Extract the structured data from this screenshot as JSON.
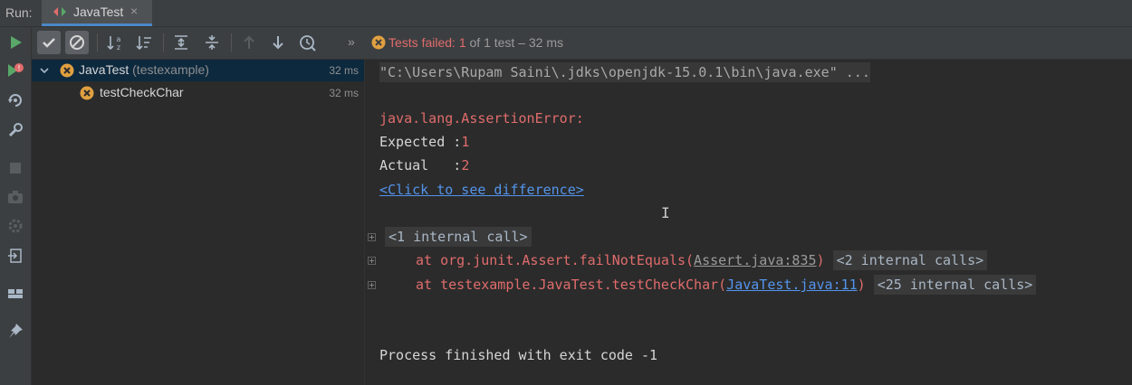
{
  "run_bar": {
    "label": "Run:",
    "tab_title": "JavaTest",
    "close_glyph": "×"
  },
  "left_toolbar": {
    "icons": [
      "run-icon",
      "rerun-failed-icon",
      "rerun-icon",
      "settings-wrench-icon",
      "stop-icon",
      "camera-icon",
      "gear-icon",
      "export-icon",
      "layout-icon",
      "pin-icon"
    ]
  },
  "test_toolbar": {
    "more_glyph": "»",
    "status": {
      "prefix": "Tests failed: ",
      "failed_count": "1",
      "suffix": " of 1 test – 32 ms"
    }
  },
  "tree": {
    "root": {
      "name": "JavaTest",
      "package": " (testexample)",
      "time": "32 ms"
    },
    "child": {
      "name": "testCheckChar",
      "time": "32 ms"
    }
  },
  "console": {
    "command": "\"C:\\Users\\Rupam Saini\\.jdks\\openjdk-15.0.1\\bin\\java.exe\" ...",
    "error": "java.lang.AssertionError:",
    "expected_label": "Expected :",
    "expected_value": "1",
    "actual_label": "Actual   :",
    "actual_value": "2",
    "diff_link": "<Click to see difference>",
    "internal_call_1": "<1 internal call>",
    "trace1_prefix": "at org.junit.Assert.failNotEquals(",
    "trace1_link": "Assert.java:835",
    "trace1_suffix": ")",
    "trace1_internal": "<2 internal calls>",
    "trace2_prefix": "at testexample.JavaTest.testCheckChar(",
    "trace2_link": "JavaTest.java:11",
    "trace2_suffix": ")",
    "trace2_internal": "<25 internal calls>",
    "exit": "Process finished with exit code -1",
    "cursor_glyph": "I"
  },
  "colors": {
    "background": "#2b2b2b",
    "panel": "#3c3f41",
    "error": "#e06c6c",
    "link": "#5394ec",
    "run_green": "#59a869",
    "fail_orange": "#e0a040"
  }
}
